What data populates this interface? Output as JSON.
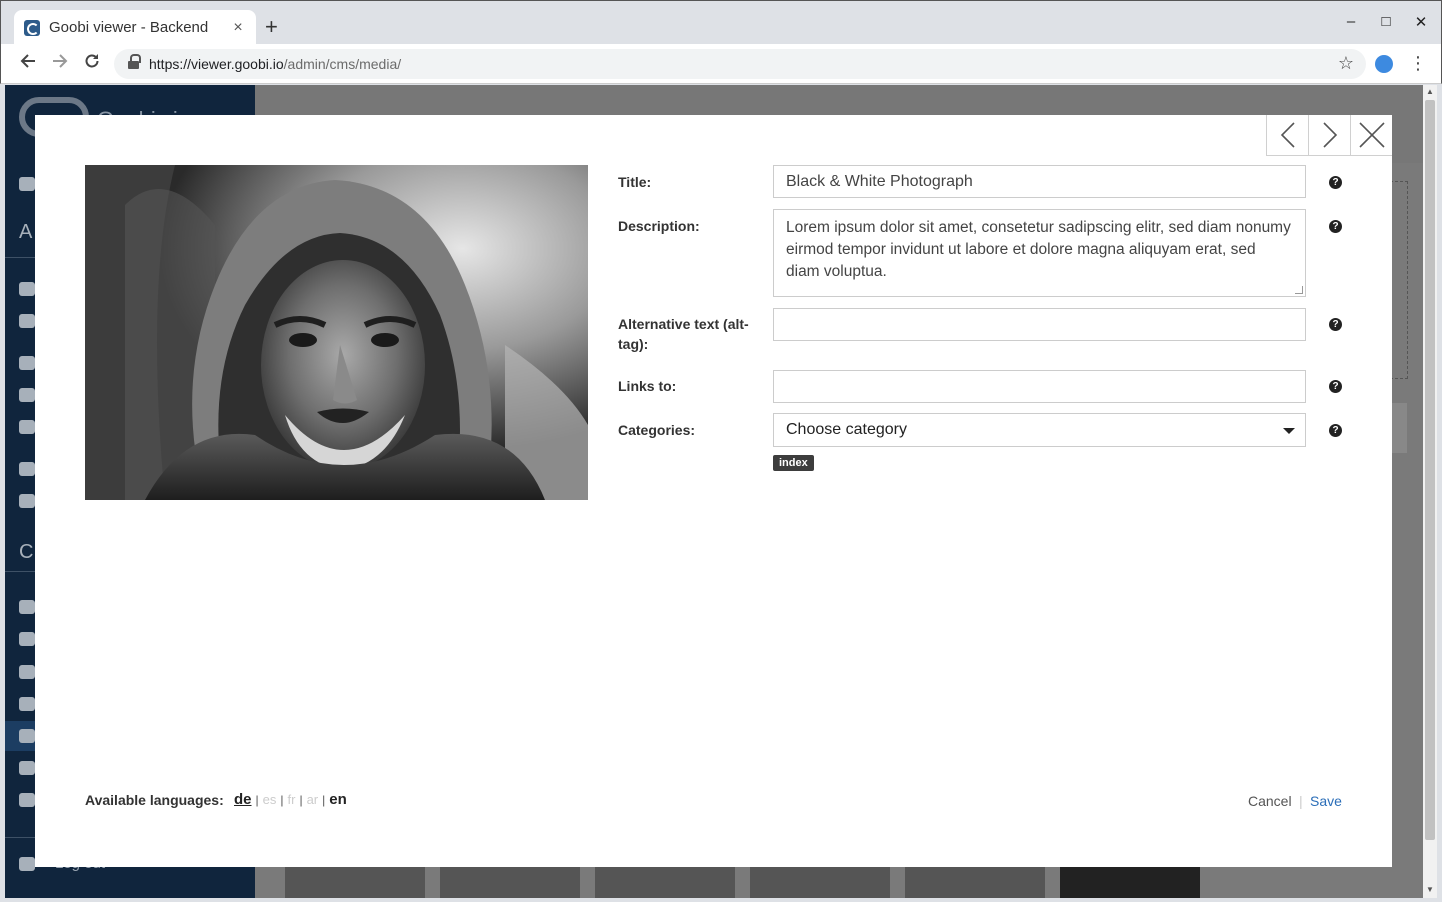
{
  "browser": {
    "tab_title": "Goobi viewer - Backend",
    "tab_close": "×",
    "new_tab": "+",
    "url_host": "https://viewer.goobi.io",
    "url_path": "/admin/cms/media/",
    "window_controls": {
      "minimize": "–",
      "maximize": "□",
      "close": "✕"
    }
  },
  "sidebar": {
    "brand": "Goobi viewer",
    "section_letters": [
      "A",
      "C"
    ],
    "logout_label": "Log out"
  },
  "modal": {
    "fields": {
      "title": {
        "label": "Title:",
        "value": "Black & White Photograph"
      },
      "description": {
        "label": "Description:",
        "value": "Lorem ipsum dolor sit amet, consetetur sadipscing elitr, sed diam nonumy eirmod tempor invidunt ut labore et dolore magna aliquyam erat, sed diam voluptua."
      },
      "alt_text": {
        "label": "Alternative text (alt-tag):",
        "value": ""
      },
      "links_to": {
        "label": "Links to:",
        "value": ""
      },
      "categories": {
        "label": "Categories:",
        "selected": "Choose category",
        "tags": [
          "index"
        ]
      }
    },
    "help_glyph": "?",
    "languages": {
      "label": "Available languages:",
      "items": [
        {
          "code": "de",
          "state": "current"
        },
        {
          "code": "es",
          "state": "disabled"
        },
        {
          "code": "fr",
          "state": "disabled"
        },
        {
          "code": "ar",
          "state": "disabled"
        },
        {
          "code": "en",
          "state": "available"
        }
      ],
      "separator": "|"
    },
    "actions": {
      "cancel": "Cancel",
      "separator": "|",
      "save": "Save"
    }
  },
  "icons": {
    "back": "arrow-left-icon",
    "forward": "arrow-right-icon",
    "reload": "reload-icon",
    "bookmark": "star-icon",
    "menu": "more-vert-icon",
    "modal_prev": "chevron-left-icon",
    "modal_next": "chevron-right-icon",
    "modal_close": "close-icon"
  },
  "colors": {
    "sidebar": "#10253d",
    "overlay": "#7a7a7a",
    "save_link": "#2b6eb8"
  }
}
